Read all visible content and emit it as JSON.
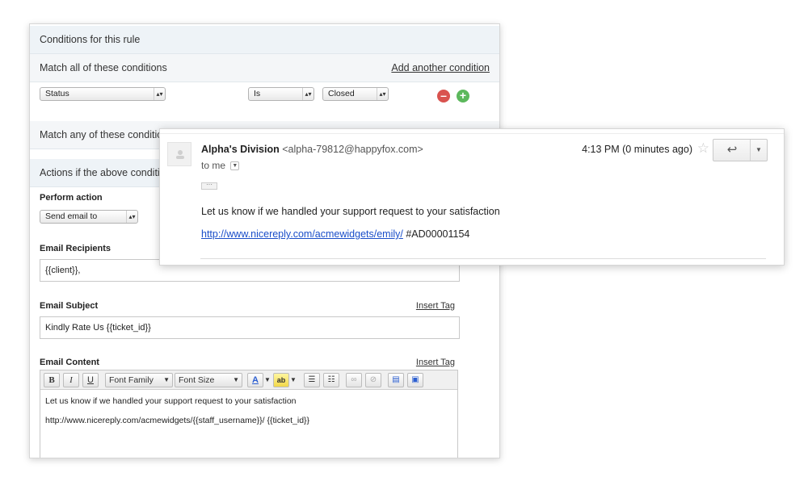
{
  "rule": {
    "conditions_header": "Conditions for this rule",
    "match_all_label": "Match all of these conditions",
    "add_condition_link": "Add another condition",
    "condition_row": {
      "field_select": "Status",
      "operator_select": "Is",
      "value_select": "Closed"
    },
    "match_any_label": "Match any of these conditions",
    "actions_header": "Actions if the above conditions",
    "perform_action_label": "Perform action",
    "perform_action_select": "Send email to",
    "recipients_label": "Email Recipients",
    "recipients_value": "{{client}},",
    "subject_label": "Email Subject",
    "subject_insert_tag": "Insert Tag",
    "subject_value": "Kindly Rate Us  {{ticket_id}}",
    "content_label": "Email Content",
    "content_insert_tag": "Insert Tag",
    "toolbar": {
      "bold": "B",
      "italic": "I",
      "underline": "U",
      "font_family": "Font Family",
      "font_size": "Font Size"
    },
    "content_line1": "Let us know if we handled your support request to your satisfaction",
    "content_line2": "http://www.nicereply.com/acmewidgets/{{staff_username}}/ {{ticket_id}}"
  },
  "email": {
    "sender_name": "Alpha's Division",
    "sender_address": "<alpha-79812@happyfox.com>",
    "to_label": "to me",
    "time": "4:13 PM (0 minutes ago)",
    "ellipsis": "···",
    "body_text": "Let us know if we handled your support request to your satisfaction",
    "link_text": "http://www.nicereply.com/acmewidgets/emily/",
    "ticket_ref": "#AD00001154"
  }
}
